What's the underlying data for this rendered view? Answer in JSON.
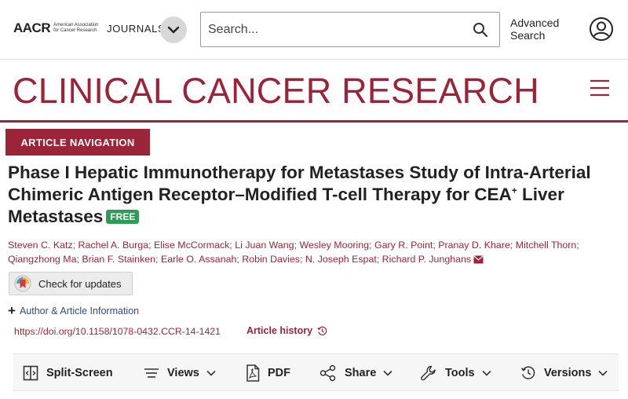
{
  "header": {
    "logo_mark": "AACR",
    "logo_tagline": "American Association for Cancer Research",
    "journals_label": "JOURNALS",
    "search_placeholder": "Search...",
    "advanced_search_line1": "Advanced",
    "advanced_search_line2": "Search"
  },
  "journal": {
    "title": "CLINICAL CANCER RESEARCH"
  },
  "article_nav": {
    "label": "ARTICLE NAVIGATION"
  },
  "article": {
    "title_part1": "Phase I Hepatic Immunotherapy for Metastases Study of Intra-Arterial Chimeric Antigen Receptor–Modified T-cell Therapy for CEA",
    "title_sup": "+",
    "title_part2": " Liver Metastases",
    "free_badge": "FREE",
    "authors": [
      "Steven C. Katz",
      "Rachel A. Burga",
      "Elise McCormack",
      "Li Juan Wang",
      "Wesley Mooring",
      "Gary R. Point",
      "Pranay D. Khare",
      "Mitchell Thorn",
      "Qiangzhong Ma",
      "Brian F. Stainken",
      "Earle O. Assanah",
      "Robin Davies",
      "N. Joseph Espat",
      "Richard P. Junghans"
    ],
    "check_updates_label": "Check for updates",
    "author_info_label": "Author & Article Information",
    "doi": "https://doi.org/10.1158/1078-0432.CCR-14-1421",
    "history_label": "Article history"
  },
  "toolbar": {
    "split_screen": "Split-Screen",
    "views": "Views",
    "pdf": "PDF",
    "share": "Share",
    "tools": "Tools",
    "versions": "Versions"
  },
  "colors": {
    "brand": "#9c2438",
    "free_badge": "#2e9b57",
    "link_blue": "#2a4a8f"
  }
}
